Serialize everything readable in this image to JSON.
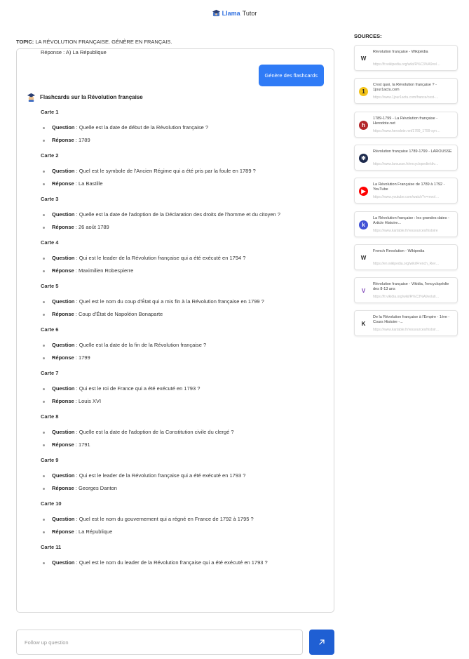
{
  "header": {
    "brand": "Llama",
    "brand_rest": "Tutor"
  },
  "topic": {
    "label": "TOPIC:",
    "value": "LA RÉVOLUTION FRANÇAISE. GÉNÈRE EN FRANÇAIS."
  },
  "chat": {
    "prev_answer": "Réponse : A) La République",
    "user_message": "Génère des flashcards",
    "bot_title": "Flashcards sur la Révolution française",
    "question_label": "Question",
    "answer_label": "Réponse",
    "cards": [
      {
        "title": "Carte 1",
        "question": " : Quelle est la date de début de la Révolution française ?",
        "answer": " : 1789"
      },
      {
        "title": "Carte 2",
        "question": " : Quel est le symbole de l'Ancien Régime qui a été pris par la foule en 1789 ?",
        "answer": " : La Bastille"
      },
      {
        "title": "Carte 3",
        "question": " : Quelle est la date de l'adoption de la Déclaration des droits de l'homme et du citoyen ?",
        "answer": " : 26 août 1789"
      },
      {
        "title": "Carte 4",
        "question": " : Qui est le leader de la Révolution française qui a été exécuté en 1794 ?",
        "answer": " : Maximilien Robespierre"
      },
      {
        "title": "Carte 5",
        "question": " : Quel est le nom du coup d'État qui a mis fin à la Révolution française en 1799 ?",
        "answer": " : Coup d'État de Napoléon Bonaparte"
      },
      {
        "title": "Carte 6",
        "question": " : Quelle est la date de la fin de la Révolution française ?",
        "answer": " : 1799"
      },
      {
        "title": "Carte 7",
        "question": " : Qui est le roi de France qui a été exécuté en 1793 ?",
        "answer": " : Louis XVI"
      },
      {
        "title": "Carte 8",
        "question": " : Quelle est la date de l'adoption de la Constitution civile du clergé ?",
        "answer": " : 1791"
      },
      {
        "title": "Carte 9",
        "question": " : Qui est le leader de la Révolution française qui a été exécuté en 1793 ?",
        "answer": " : Georges Danton"
      },
      {
        "title": "Carte 10",
        "question": " : Quel est le nom du gouvernement qui a régné en France de 1792 à 1795 ?",
        "answer": " : La République"
      },
      {
        "title": "Carte 11",
        "question": " : Quel est le nom du leader de la Révolution française qui a été exécuté en 1793 ?",
        "answer": ""
      }
    ]
  },
  "followup": {
    "placeholder": "Follow up question"
  },
  "sources": {
    "title": "SOURCES:",
    "items": [
      {
        "title": "Révolution française - Wikipédia",
        "url": "https://fr.wikipedia.org/wiki/R%C3%A9volution_fran%C3%A7aise",
        "icon": "W",
        "icon_bg": "#ffffff",
        "icon_color": "#333333"
      },
      {
        "title": "C'est quoi, la Révolution française ? - 1jour1actu.com",
        "url": "https://www.1jour1actu.com/france/cest-quoi-la-revolution",
        "icon": "1",
        "icon_bg": "#f3c319",
        "icon_color": "#222222"
      },
      {
        "title": "1789-1799 - La Révolution française - Herodote.net",
        "url": "https://www.herodote.net/1789_1799-synthese",
        "icon": "h",
        "icon_bg": "#b3262a",
        "icon_color": "#ffffff"
      },
      {
        "title": "Révolution française 1789-1799 - LAROUSSE",
        "url": "https://www.larousse.fr/encyclopedie/divers/R%C3%A9volution",
        "icon": "✻",
        "icon_bg": "#1d2a4d",
        "icon_color": "#ffffff"
      },
      {
        "title": "La Révolution Française de 1789 à 1792 - YouTube",
        "url": "https://www.youtube.com/watch?v=revolution",
        "icon": "▶",
        "icon_bg": "#ff0000",
        "icon_color": "#ffffff"
      },
      {
        "title": "La Révolution française : les grandes dates - Article Histoire...",
        "url": "https://www.kartable.fr/ressources/histoire",
        "icon": "k",
        "icon_bg": "#4152d6",
        "icon_color": "#ffffff"
      },
      {
        "title": "French Revolution - Wikipedia",
        "url": "https://en.wikipedia.org/wiki/French_Revolution",
        "icon": "W",
        "icon_bg": "#ffffff",
        "icon_color": "#333333"
      },
      {
        "title": "Révolution française - Vikidia, l'encyclopédie des 8-13 ans",
        "url": "https://fr.vikidia.org/wiki/R%C3%A9volution_fran%C3%A7aise",
        "icon": "V",
        "icon_bg": "#ffffff",
        "icon_color": "#7a3fb5"
      },
      {
        "title": "De la Révolution française à l'Empire - 1ère - Cours Histoire -...",
        "url": "https://www.kartable.fr/ressources/histoire/cours",
        "icon": "K",
        "icon_bg": "#ffffff",
        "icon_color": "#222222"
      }
    ]
  }
}
